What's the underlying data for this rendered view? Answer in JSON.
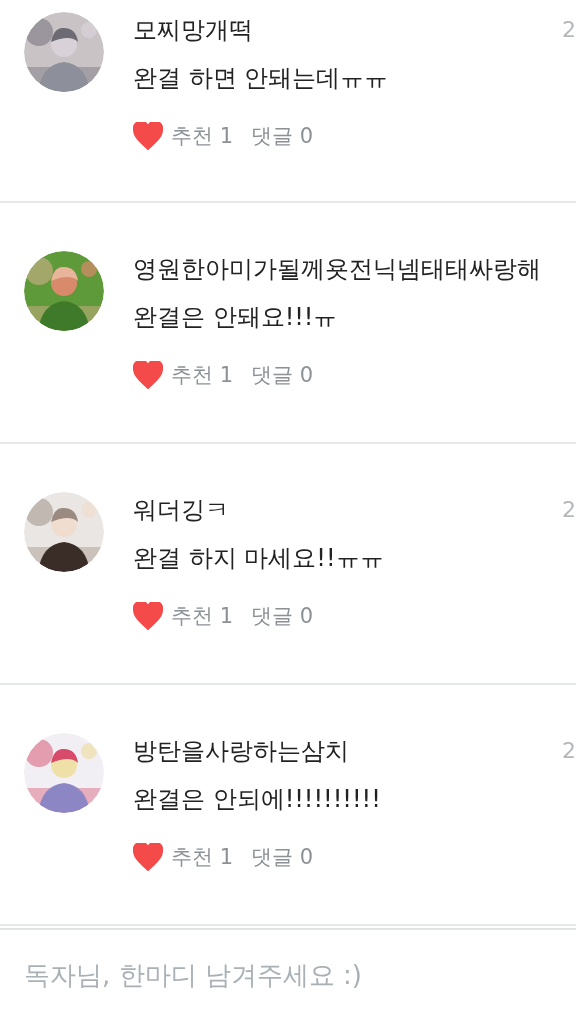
{
  "comments": [
    {
      "author": "모찌망개떡",
      "date": "2",
      "text": "완결 하면 안돼는데ㅠㅠ",
      "liked": true,
      "likes": "추천 1",
      "replies": "댓글 0"
    },
    {
      "author": "영원한아미가될께욧전닉넴태태싸랑해",
      "text": "완결은 안돼요!!!ㅠ",
      "liked": true,
      "likes": "추천 1",
      "replies": "댓글 0"
    },
    {
      "author": "워더깅ㅋ",
      "date": "2",
      "text": "완결 하지 마세요!!ㅠㅠ",
      "liked": true,
      "likes": "추천 1",
      "replies": "댓글 0"
    },
    {
      "author": "방탄을사랑하는삼치",
      "date": "2",
      "text": "완결은 안되에!!!!!!!!!!",
      "liked": true,
      "likes": "추천 1",
      "replies": "댓글 0"
    }
  ],
  "input": {
    "placeholder": "독자님, 한마디 남겨주세요 :)"
  }
}
